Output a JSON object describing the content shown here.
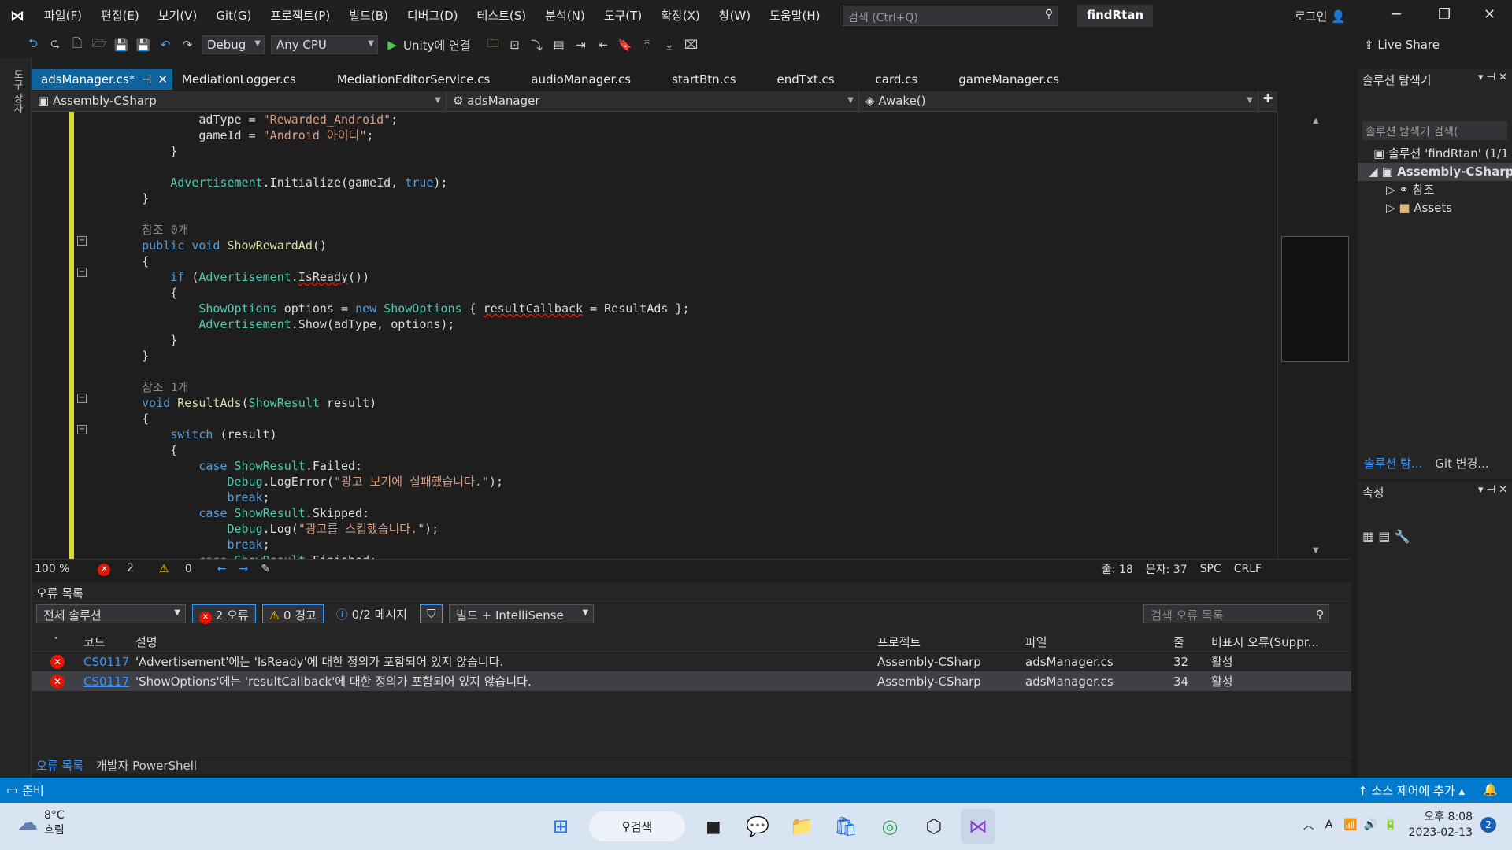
{
  "menubar": {
    "items": [
      "파일(F)",
      "편집(E)",
      "보기(V)",
      "Git(G)",
      "프로젝트(P)",
      "빌드(B)",
      "디버그(D)",
      "테스트(S)",
      "분석(N)",
      "도구(T)",
      "확장(X)",
      "창(W)",
      "도움말(H)"
    ],
    "search_placeholder": "검색 (Ctrl+Q)",
    "solution_name": "findRtan",
    "login": "로그인"
  },
  "toolbar": {
    "config": "Debug",
    "platform": "Any CPU",
    "run_label": "Unity에 연결",
    "live_share": "Live Share"
  },
  "leftstrip": {
    "label": "도구 상자"
  },
  "tabs": [
    "adsManager.cs*",
    "MediationLogger.cs",
    "MediationEditorService.cs",
    "audioManager.cs",
    "startBtn.cs",
    "endTxt.cs",
    "card.cs",
    "gameManager.cs"
  ],
  "navbar": {
    "project": "Assembly-CSharp",
    "class": "adsManager",
    "member": "Awake()"
  },
  "code_lines": [
    [
      {
        "t": "            adType = ",
        "c": ""
      },
      {
        "t": "\"Rewarded_Android\"",
        "c": "st"
      },
      {
        "t": ";",
        "c": ""
      }
    ],
    [
      {
        "t": "            gameId = ",
        "c": ""
      },
      {
        "t": "\"Android 아이디\"",
        "c": "st"
      },
      {
        "t": ";",
        "c": ""
      }
    ],
    [
      {
        "t": "        }",
        "c": ""
      }
    ],
    [
      {
        "t": "",
        "c": ""
      }
    ],
    [
      {
        "t": "        ",
        "c": ""
      },
      {
        "t": "Advertisement",
        "c": "ty"
      },
      {
        "t": ".Initialize(gameId, ",
        "c": ""
      },
      {
        "t": "true",
        "c": "kw"
      },
      {
        "t": ");",
        "c": ""
      }
    ],
    [
      {
        "t": "    }",
        "c": ""
      }
    ],
    [
      {
        "t": "",
        "c": ""
      }
    ],
    [
      {
        "t": "    참조 0개",
        "c": "cm"
      }
    ],
    [
      {
        "t": "    ",
        "c": ""
      },
      {
        "t": "public",
        "c": "kw"
      },
      {
        "t": " ",
        "c": ""
      },
      {
        "t": "void",
        "c": "kw"
      },
      {
        "t": " ",
        "c": ""
      },
      {
        "t": "ShowRewardAd",
        "c": "fn"
      },
      {
        "t": "()",
        "c": ""
      }
    ],
    [
      {
        "t": "    {",
        "c": ""
      }
    ],
    [
      {
        "t": "        ",
        "c": ""
      },
      {
        "t": "if",
        "c": "kw"
      },
      {
        "t": " (",
        "c": ""
      },
      {
        "t": "Advertisement",
        "c": "ty"
      },
      {
        "t": ".",
        "c": ""
      },
      {
        "t": "IsReady",
        "c": "sq"
      },
      {
        "t": "())",
        "c": ""
      }
    ],
    [
      {
        "t": "        {",
        "c": ""
      }
    ],
    [
      {
        "t": "            ",
        "c": ""
      },
      {
        "t": "ShowOptions",
        "c": "ty"
      },
      {
        "t": " options = ",
        "c": ""
      },
      {
        "t": "new",
        "c": "kw"
      },
      {
        "t": " ",
        "c": ""
      },
      {
        "t": "ShowOptions",
        "c": "ty"
      },
      {
        "t": " { ",
        "c": ""
      },
      {
        "t": "resultCallback",
        "c": "sq"
      },
      {
        "t": " = ResultAds };",
        "c": ""
      }
    ],
    [
      {
        "t": "            ",
        "c": ""
      },
      {
        "t": "Advertisement",
        "c": "ty"
      },
      {
        "t": ".Show(adType, options);",
        "c": ""
      }
    ],
    [
      {
        "t": "        }",
        "c": ""
      }
    ],
    [
      {
        "t": "    }",
        "c": ""
      }
    ],
    [
      {
        "t": "",
        "c": ""
      }
    ],
    [
      {
        "t": "    참조 1개",
        "c": "cm"
      }
    ],
    [
      {
        "t": "    ",
        "c": ""
      },
      {
        "t": "void",
        "c": "kw"
      },
      {
        "t": " ",
        "c": ""
      },
      {
        "t": "ResultAds",
        "c": "fn"
      },
      {
        "t": "(",
        "c": ""
      },
      {
        "t": "ShowResult",
        "c": "ty"
      },
      {
        "t": " result)",
        "c": ""
      }
    ],
    [
      {
        "t": "    {",
        "c": ""
      }
    ],
    [
      {
        "t": "        ",
        "c": ""
      },
      {
        "t": "switch",
        "c": "kw"
      },
      {
        "t": " (result)",
        "c": ""
      }
    ],
    [
      {
        "t": "        {",
        "c": ""
      }
    ],
    [
      {
        "t": "            ",
        "c": ""
      },
      {
        "t": "case",
        "c": "kw"
      },
      {
        "t": " ",
        "c": ""
      },
      {
        "t": "ShowResult",
        "c": "ty"
      },
      {
        "t": ".Failed:",
        "c": ""
      }
    ],
    [
      {
        "t": "                ",
        "c": ""
      },
      {
        "t": "Debug",
        "c": "ty"
      },
      {
        "t": ".LogError(",
        "c": ""
      },
      {
        "t": "\"광고 보기에 실패했습니다.\"",
        "c": "st"
      },
      {
        "t": ");",
        "c": ""
      }
    ],
    [
      {
        "t": "                ",
        "c": ""
      },
      {
        "t": "break",
        "c": "kw"
      },
      {
        "t": ";",
        "c": ""
      }
    ],
    [
      {
        "t": "            ",
        "c": ""
      },
      {
        "t": "case",
        "c": "kw"
      },
      {
        "t": " ",
        "c": ""
      },
      {
        "t": "ShowResult",
        "c": "ty"
      },
      {
        "t": ".Skipped:",
        "c": ""
      }
    ],
    [
      {
        "t": "                ",
        "c": ""
      },
      {
        "t": "Debug",
        "c": "ty"
      },
      {
        "t": ".Log(",
        "c": ""
      },
      {
        "t": "\"광고를 스킵했습니다.\"",
        "c": "st"
      },
      {
        "t": ");",
        "c": ""
      }
    ],
    [
      {
        "t": "                ",
        "c": ""
      },
      {
        "t": "break",
        "c": "kw"
      },
      {
        "t": ";",
        "c": ""
      }
    ],
    [
      {
        "t": "            ",
        "c": ""
      },
      {
        "t": "case",
        "c": "kw"
      },
      {
        "t": " ",
        "c": ""
      },
      {
        "t": "ShowResult",
        "c": "ty"
      },
      {
        "t": ".Finished:",
        "c": ""
      }
    ]
  ],
  "editor_status": {
    "zoom": "100 %",
    "errors": "2",
    "warnings": "0",
    "line": "줄: 18",
    "col": "문자: 37",
    "spc": "SPC",
    "crlf": "CRLF"
  },
  "errorlist": {
    "title": "오류 목록",
    "scope": "전체 솔루션",
    "errors_btn": "2 오류",
    "warnings_btn": "0 경고",
    "messages_btn": "0/2 메시지",
    "source": "빌드 + IntelliSense",
    "search_placeholder": "검색 오류 목록",
    "headers": [
      "코드",
      "설명",
      "프로젝트",
      "파일",
      "줄",
      "비표시 오류(Suppr..."
    ],
    "rows": [
      {
        "code": "CS0117",
        "desc": "'Advertisement'에는 'IsReady'에 대한 정의가 포함되어 있지 않습니다.",
        "project": "Assembly-CSharp",
        "file": "adsManager.cs",
        "line": "32",
        "state": "활성"
      },
      {
        "code": "CS0117",
        "desc": "'ShowOptions'에는 'resultCallback'에 대한 정의가 포함되어 있지 않습니다.",
        "project": "Assembly-CSharp",
        "file": "adsManager.cs",
        "line": "34",
        "state": "활성"
      }
    ],
    "tabs": [
      "오류 목록",
      "개발자 PowerShell"
    ]
  },
  "solution_explorer": {
    "title": "솔루션 탐색기",
    "search": "솔루션 탐색기 검색(",
    "tree": [
      "솔루션 'findRtan' (1/1",
      "Assembly-CSharp",
      "참조",
      "Assets"
    ],
    "tabs": [
      "솔루션 탐...",
      "Git 변경..."
    ]
  },
  "properties": {
    "title": "속성"
  },
  "statusbar": {
    "left": "준비",
    "right": "소스 제어에 추가"
  },
  "taskbar": {
    "temp": "8°C",
    "weather": "흐림",
    "search": "검색",
    "time": "오후 8:08",
    "date": "2023-02-13",
    "notif": "2"
  }
}
